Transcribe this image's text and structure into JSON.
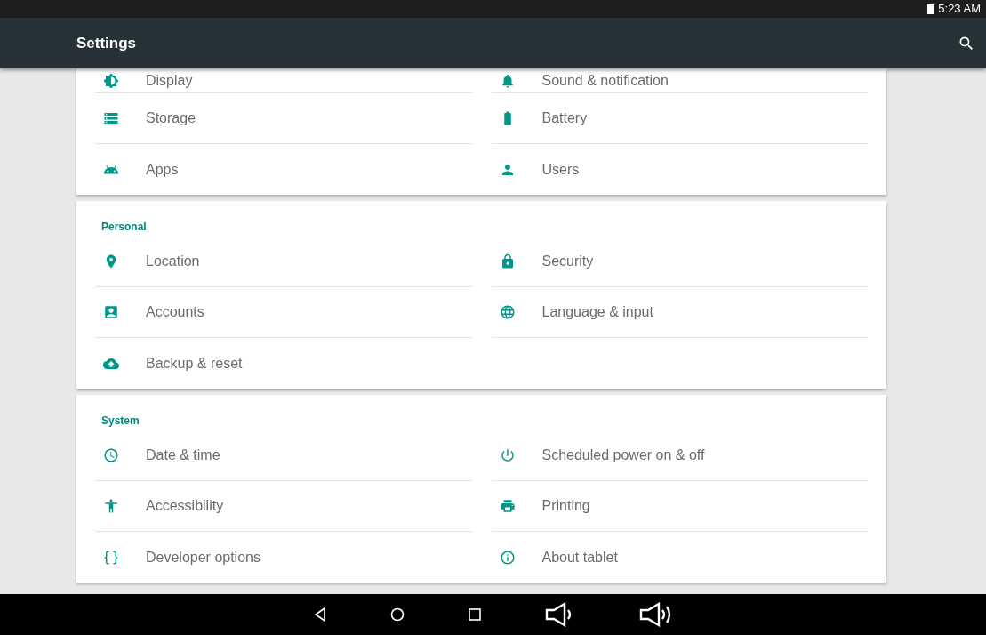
{
  "status_bar": {
    "time": "5:23 AM"
  },
  "app_bar": {
    "title": "Settings"
  },
  "sections": [
    {
      "items": [
        "Display",
        "Sound & notification",
        "Storage",
        "Battery",
        "Apps",
        "Users"
      ]
    },
    {
      "header": "Personal",
      "items": [
        "Location",
        "Security",
        "Accounts",
        "Language & input",
        "Backup & reset"
      ]
    },
    {
      "header": "System",
      "items": [
        "Date & time",
        "Scheduled power on & off",
        "Accessibility",
        "Printing",
        "Developer options",
        "About tablet"
      ]
    }
  ]
}
